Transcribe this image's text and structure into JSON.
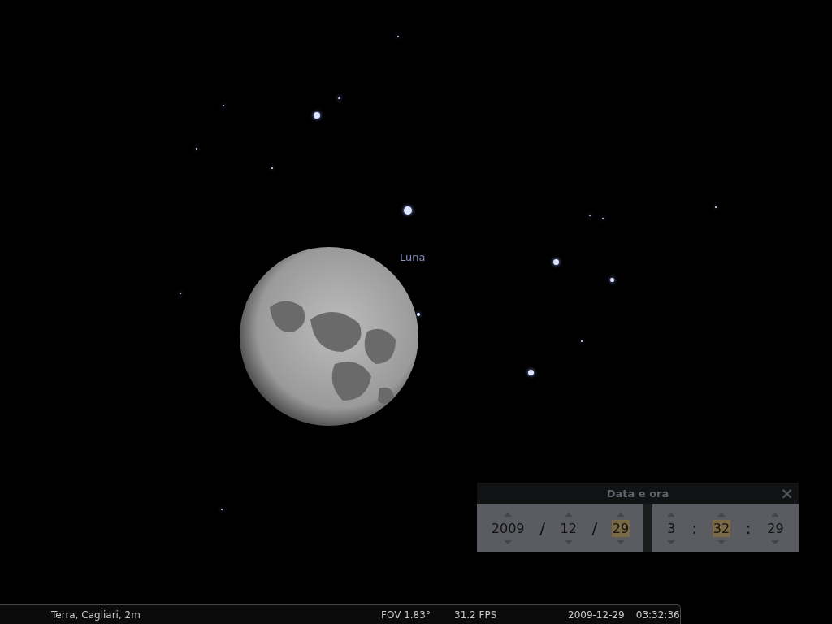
{
  "sky": {
    "object_label": "Luna"
  },
  "dialog": {
    "title": "Data e ora",
    "close": "×",
    "date": [
      {
        "value": "2009",
        "selected": false
      },
      {
        "sep": "/"
      },
      {
        "value": "12",
        "selected": false
      },
      {
        "sep": "/"
      },
      {
        "value": "29",
        "selected": true
      }
    ],
    "time": [
      {
        "value": "3",
        "selected": false
      },
      {
        "sep": ":"
      },
      {
        "value": "32",
        "selected": true
      },
      {
        "sep": ":"
      },
      {
        "value": "29",
        "selected": false
      }
    ]
  },
  "status_bar": {
    "location": "Terra, Cagliari, 2m",
    "fov": "FOV 1.83°",
    "fps": "31.2 FPS",
    "date": "2009-12-29",
    "time": "03:32:36"
  }
}
